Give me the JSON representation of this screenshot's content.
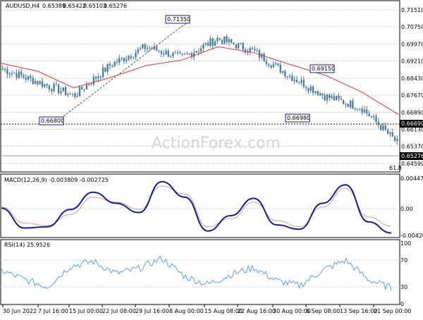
{
  "main": {
    "header": {
      "symbol": "AUDUSD,H4",
      "open": "0.65389",
      "high": "0.65422",
      "low": "0.65103",
      "close": "0.65276"
    },
    "watermark": "ActionForex.com",
    "price_tags": {
      "level": "0.66690",
      "current": "0.65276"
    },
    "pivot_labels": [
      {
        "text": "0.71350",
        "price": 0.7135
      },
      {
        "text": "0.66800",
        "price": 0.668
      },
      {
        "text": "0.69150",
        "price": 0.6915
      },
      {
        "text": "0.66980",
        "price": 0.6698
      }
    ],
    "fib_label": "61.8"
  },
  "macd": {
    "label": "MACD(12,26,9) -0.003809 -0.002725",
    "ticks": [
      "0.004478",
      "0.00",
      "-0.004204"
    ]
  },
  "rsi": {
    "label": "RSI(14) 25.9526",
    "ticks": [
      "100",
      "70",
      "30",
      "0"
    ]
  },
  "x_ticks": [
    "30 Jun 2022",
    "7 Jul 16:00",
    "15 Jul 00:00",
    "22 Jul 08:00",
    "29 Jul 16:00",
    "8 Aug 00:00",
    "15 Aug 08:00",
    "22 Aug 16:00",
    "30 Aug 00:00",
    "6 Sep 08:00",
    "13 Sep 16:00",
    "21 Sep 00:00"
  ],
  "colors": {
    "candle": "#4a7a9c",
    "ma": "#e0303c",
    "macd_line": "#1a1a8c",
    "macd_signal": "#c8a0a0",
    "rsi_line": "#5aa0e0",
    "tag_bg": "#000000",
    "tag_border": "#1a1a8c",
    "label_bg": "#ffffff",
    "grid": "#c8c8c8"
  },
  "chart_data": [
    {
      "type": "candlestick",
      "title": "AUDUSD,H4",
      "y_ticks": [
        "0.71510",
        "0.70750",
        "0.69970",
        "0.69210",
        "0.68430",
        "0.67670",
        "0.66890",
        "0.66130",
        "0.65370",
        "0.64590"
      ],
      "ylim": [
        0.6459,
        0.7151
      ],
      "x": [
        "30 Jun",
        "7 Jul",
        "15 Jul",
        "22 Jul",
        "29 Jul",
        "8 Aug",
        "15 Aug",
        "22 Aug",
        "30 Aug",
        "6 Sep",
        "13 Sep",
        "21 Sep"
      ],
      "close": [
        0.6885,
        0.6825,
        0.6765,
        0.6902,
        0.6985,
        0.6935,
        0.7022,
        0.6965,
        0.6855,
        0.6762,
        0.6712,
        0.6552
      ],
      "low": [
        0.682,
        0.679,
        0.668,
        0.686,
        0.692,
        0.69,
        0.696,
        0.69,
        0.682,
        0.6698,
        0.668,
        0.651
      ],
      "high": [
        0.692,
        0.687,
        0.681,
        0.694,
        0.705,
        0.708,
        0.7135,
        0.701,
        0.695,
        0.6915,
        0.678,
        0.669
      ],
      "moving_average": [
        0.691,
        0.6875,
        0.68,
        0.6845,
        0.69,
        0.6925,
        0.6985,
        0.6958,
        0.6905,
        0.6855,
        0.678,
        0.668
      ]
    },
    {
      "type": "line",
      "title": "MACD(12,26,9) -0.003809 -0.002725",
      "ylim": [
        -0.004204,
        0.004478
      ],
      "series": [
        {
          "name": "MACD",
          "values": [
            0.0002,
            -0.003,
            -0.0028,
            0.0,
            0.0028,
            0.001,
            -0.0005,
            0.0045,
            0.002,
            -0.0035,
            -0.001,
            0.0018,
            -0.0025,
            -0.0032,
            0.001,
            0.004,
            -0.002,
            -0.0038
          ]
        },
        {
          "name": "Signal",
          "values": [
            0.0004,
            -0.0022,
            -0.0026,
            -0.0008,
            0.002,
            0.0012,
            0.0,
            0.0038,
            0.0025,
            -0.0028,
            -0.0015,
            0.0012,
            -0.0018,
            -0.0028,
            0.0004,
            0.0034,
            -0.0012,
            -0.0027
          ]
        }
      ]
    },
    {
      "type": "line",
      "title": "RSI(14) 25.9526",
      "ylim": [
        0,
        100
      ],
      "y_ticks": [
        100,
        70,
        30,
        0
      ],
      "series": [
        {
          "name": "RSI(14)",
          "values": [
            55,
            40,
            28,
            62,
            70,
            50,
            58,
            75,
            45,
            32,
            48,
            60,
            38,
            30,
            55,
            72,
            40,
            26
          ]
        }
      ]
    }
  ]
}
